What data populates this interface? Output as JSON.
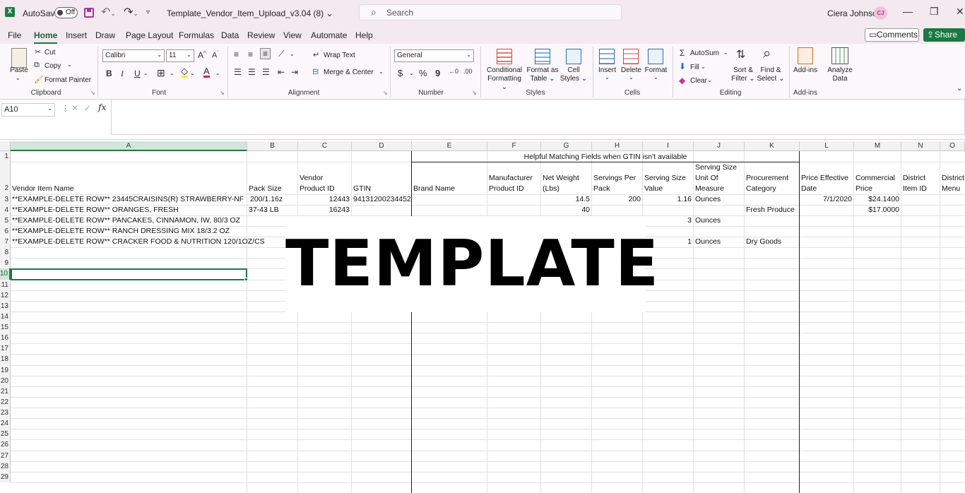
{
  "titlebar": {
    "autosave_label": "AutoSave",
    "autosave_state": "Off",
    "filename": "Template_Vendor_Item_Upload_v3.04 (8)",
    "search_placeholder": "Search",
    "user_name": "Ciera Johnson",
    "user_initials": "CJ"
  },
  "menu": {
    "tabs": [
      "File",
      "Home",
      "Insert",
      "Draw",
      "Page Layout",
      "Formulas",
      "Data",
      "Review",
      "View",
      "Automate",
      "Help"
    ],
    "active": "Home",
    "comments": "Comments",
    "share": "Share"
  },
  "ribbon": {
    "clipboard": {
      "paste": "Paste",
      "cut": "Cut",
      "copy": "Copy",
      "format_painter": "Format Painter",
      "label": "Clipboard"
    },
    "font": {
      "name": "Calibri",
      "size": "11",
      "label": "Font",
      "bold": "B",
      "italic": "I",
      "underline": "U"
    },
    "alignment": {
      "wrap_text": "Wrap Text",
      "merge_center": "Merge & Center",
      "label": "Alignment"
    },
    "number": {
      "format": "General",
      "label": "Number",
      "currency": "$",
      "percent": "%",
      "comma": "9"
    },
    "styles": {
      "conditional": [
        "Conditional",
        "Formatting"
      ],
      "format_table": [
        "Format as",
        "Table"
      ],
      "cell_styles": [
        "Cell",
        "Styles"
      ],
      "label": "Styles"
    },
    "cells": {
      "insert": "Insert",
      "delete": "Delete",
      "format": "Format",
      "label": "Cells"
    },
    "editing": {
      "autosum": "AutoSum",
      "fill": "Fill",
      "clear": "Clear",
      "sort_filter": [
        "Sort &",
        "Filter"
      ],
      "find_select": [
        "Find &",
        "Select"
      ],
      "label": "Editing"
    },
    "addins": {
      "addins": "Add-ins",
      "analyze": [
        "Analyze",
        "Data"
      ],
      "label": "Add-ins"
    }
  },
  "formula_bar": {
    "name_box": "A10",
    "fx": "fx",
    "value": ""
  },
  "sheet": {
    "columns": [
      "A",
      "B",
      "C",
      "D",
      "E",
      "F",
      "G",
      "H",
      "I",
      "J",
      "K",
      "L",
      "M",
      "N",
      "O"
    ],
    "row_numbers": [
      "1",
      "2",
      "3",
      "4",
      "5",
      "6",
      "7",
      "8",
      "9",
      "10",
      "11",
      "12",
      "13",
      "14",
      "15",
      "16",
      "17",
      "18",
      "19",
      "20",
      "21",
      "22",
      "23",
      "24",
      "25",
      "26",
      "27",
      "28",
      "29"
    ],
    "selected_cell": "A10",
    "merged_title": "Helpful Matching Fields when GTIN isn't available",
    "headers": {
      "A": "Vendor Item Name",
      "B": "Pack Size",
      "C": "Vendor Product ID",
      "D": "GTIN",
      "E": "Brand Name",
      "F": "Manufacturer Product ID",
      "G": "Net Weight (Lbs)",
      "H": "Servings Per Pack",
      "I": "Serving Size Value",
      "J": "Serving Size Unit Of Measure",
      "K": "Procurement Category",
      "L": "Price Effective Date",
      "M": "Commercial Price",
      "N": "District Item ID",
      "O": "District Menu"
    },
    "rows": [
      {
        "A": "**EXAMPLE-DELETE ROW** 23445CRAISINS(R) STRAWBERRY-NF",
        "B": "200/1.16z",
        "C": "12443",
        "D": "94131200234452",
        "G": "14.5",
        "H": "200",
        "I": "1.16",
        "J": "Ounces",
        "L": "7/1/2020",
        "M": "$24.1400"
      },
      {
        "A": "**EXAMPLE-DELETE ROW** ORANGES, FRESH",
        "B": "37-43 LB",
        "C": "16243",
        "G": "40",
        "K": "Fresh Produce",
        "M": "$17.0000"
      },
      {
        "A": "**EXAMPLE-DELETE ROW** PANCAKES, CINNAMON, IW, 80/3 OZ",
        "I": "3",
        "J": "Ounces"
      },
      {
        "A": "**EXAMPLE-DELETE ROW** RANCH DRESSING MIX 18/3.2 OZ"
      },
      {
        "A": "**EXAMPLE-DELETE ROW** CRACKER FOOD & NUTRITION 120/1OZ/CS",
        "I": "1",
        "J": "Ounces",
        "K": "Dry Goods"
      }
    ],
    "watermark": "TEMPLATE"
  }
}
